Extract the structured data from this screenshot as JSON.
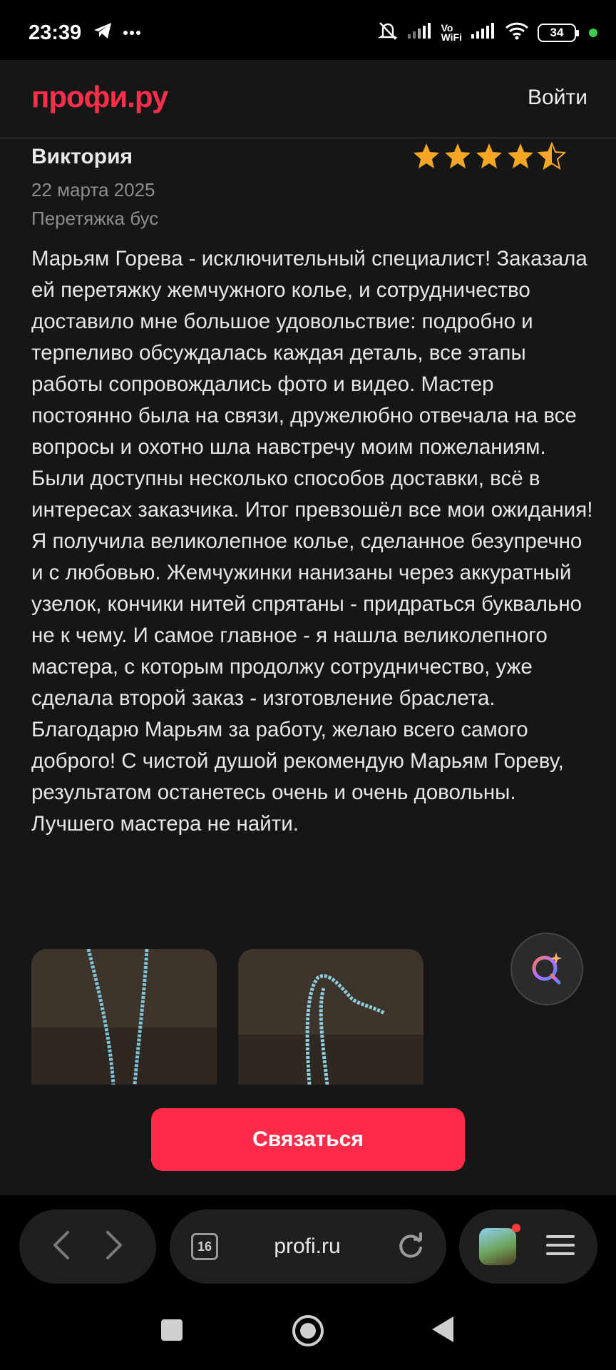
{
  "status_bar": {
    "time": "23:39",
    "vowifi_line1": "Vo",
    "vowifi_line2": "WiFi",
    "battery": "34",
    "icons": [
      "telegram-icon",
      "more-dots-icon",
      "bell-muted-icon",
      "signal-icon",
      "signal-icon",
      "wifi-icon",
      "battery-icon"
    ]
  },
  "header": {
    "logo": "профи.ру",
    "login_label": "Войти"
  },
  "review": {
    "author": "Виктория",
    "rating": 4.5,
    "rating_max": 5,
    "date": "22 марта 2025",
    "service": "Перетяжка бус",
    "text": "Марьям Горева - исключительный специалист! Заказала ей перетяжку жемчужного колье, и сотрудничество доставило мне большое удовольствие: подробно и терпеливо обсуждалась каждая деталь, все этапы работы сопровождались фото и видео. Мастер постоянно была на связи, дружелюбно отвечала на все вопросы и охотно шла навстречу моим пожеланиям. Были доступны несколько способов доставки, всё в интересах заказчика. Итог превзошёл все мои ожидания! Я получила великолепное колье, сделанное безупречно и с любовью. Жемчужинки нанизаны через аккуратный узелок, кончики нитей спрятаны - придраться буквально не к чему. И самое главное - я нашла великолепного мастера, с которым продолжу сотрудничество, уже сделала второй заказ - изготовление браслета. Благодарю Марьям за работу, желаю всего самого доброго! С чистой душой рекомендую Марьям Гореву, результатом останетесь очень и очень довольны. Лучшего мастера не найти.",
    "colors": {
      "star": "#f5a623",
      "accent": "#ff2b48"
    }
  },
  "contact_button": {
    "label": "Связаться"
  },
  "browser": {
    "tabs_count": "16",
    "url": "profi.ru"
  }
}
